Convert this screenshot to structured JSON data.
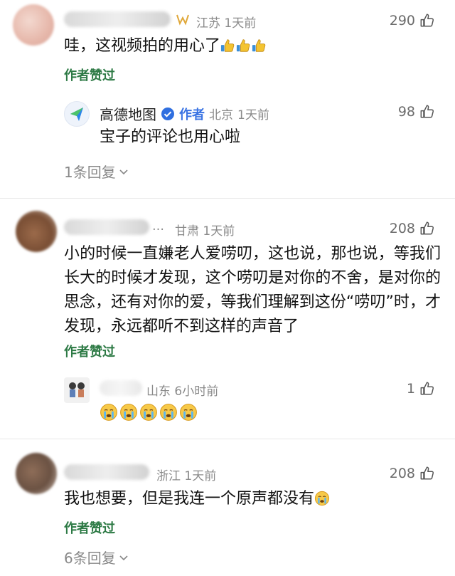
{
  "comments": [
    {
      "location": "江苏",
      "time": "1天前",
      "likes": "290",
      "text": "哇，这视频拍的用心了",
      "text_emoji": [
        "thumbs-up-icon",
        "thumbs-up-icon",
        "thumbs-up-icon"
      ],
      "approved": "作者赞过",
      "reply": {
        "name": "高德地图",
        "author_tag": "作者",
        "location": "北京",
        "time": "1天前",
        "likes": "98",
        "text": "宝子的评论也用心啦"
      },
      "replies_label": "1条回复"
    },
    {
      "name_truncated": "…",
      "location": "甘肃",
      "time": "1天前",
      "likes": "208",
      "text": "小的时候一直嫌老人爱唠叨，这也说，那也说，等我们长大的时候才发现，这个唠叨是对你的不舍，是对你的思念，还有对你的爱，等我们理解到这份“唠叨”时，才发现，永远都听不到这样的声音了",
      "approved": "作者赞过",
      "reply": {
        "location": "山东",
        "time": "6小时前",
        "likes": "1",
        "text_emoji": [
          "crying-face-icon",
          "crying-face-icon",
          "crying-face-icon",
          "crying-face-icon",
          "crying-face-icon"
        ]
      }
    },
    {
      "location": "浙江",
      "time": "1天前",
      "likes": "208",
      "text": "我也想要，但是我连一个原声都没有",
      "text_emoji": [
        "crying-face-icon"
      ],
      "approved": "作者赞过",
      "replies_label": "6条回复"
    }
  ],
  "colors": {
    "approved": "#2d7a45",
    "author_tag": "#3b74e3",
    "meta": "#8a8a8a"
  }
}
